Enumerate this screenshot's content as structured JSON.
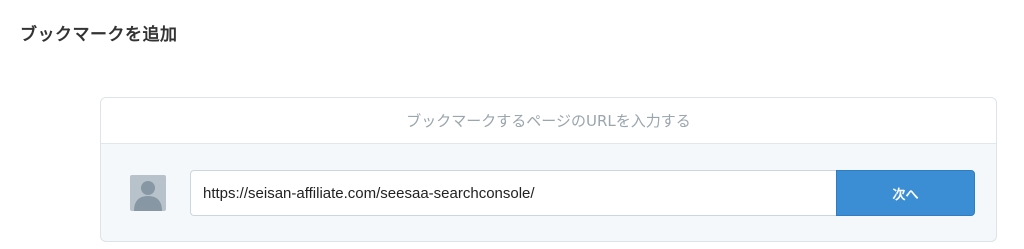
{
  "page": {
    "title": "ブックマークを追加"
  },
  "card": {
    "header_text": "ブックマークするページのURLを入力する",
    "url_input": {
      "value": "https://seisan-affiliate.com/seesaa-searchconsole/",
      "placeholder": ""
    },
    "next_button_label": "次へ",
    "avatar_icon": "default-user-avatar-icon"
  },
  "colors": {
    "accent": "#3b8ed4",
    "card_bg": "#f5f8fa",
    "header_text": "#9aa5ad"
  }
}
